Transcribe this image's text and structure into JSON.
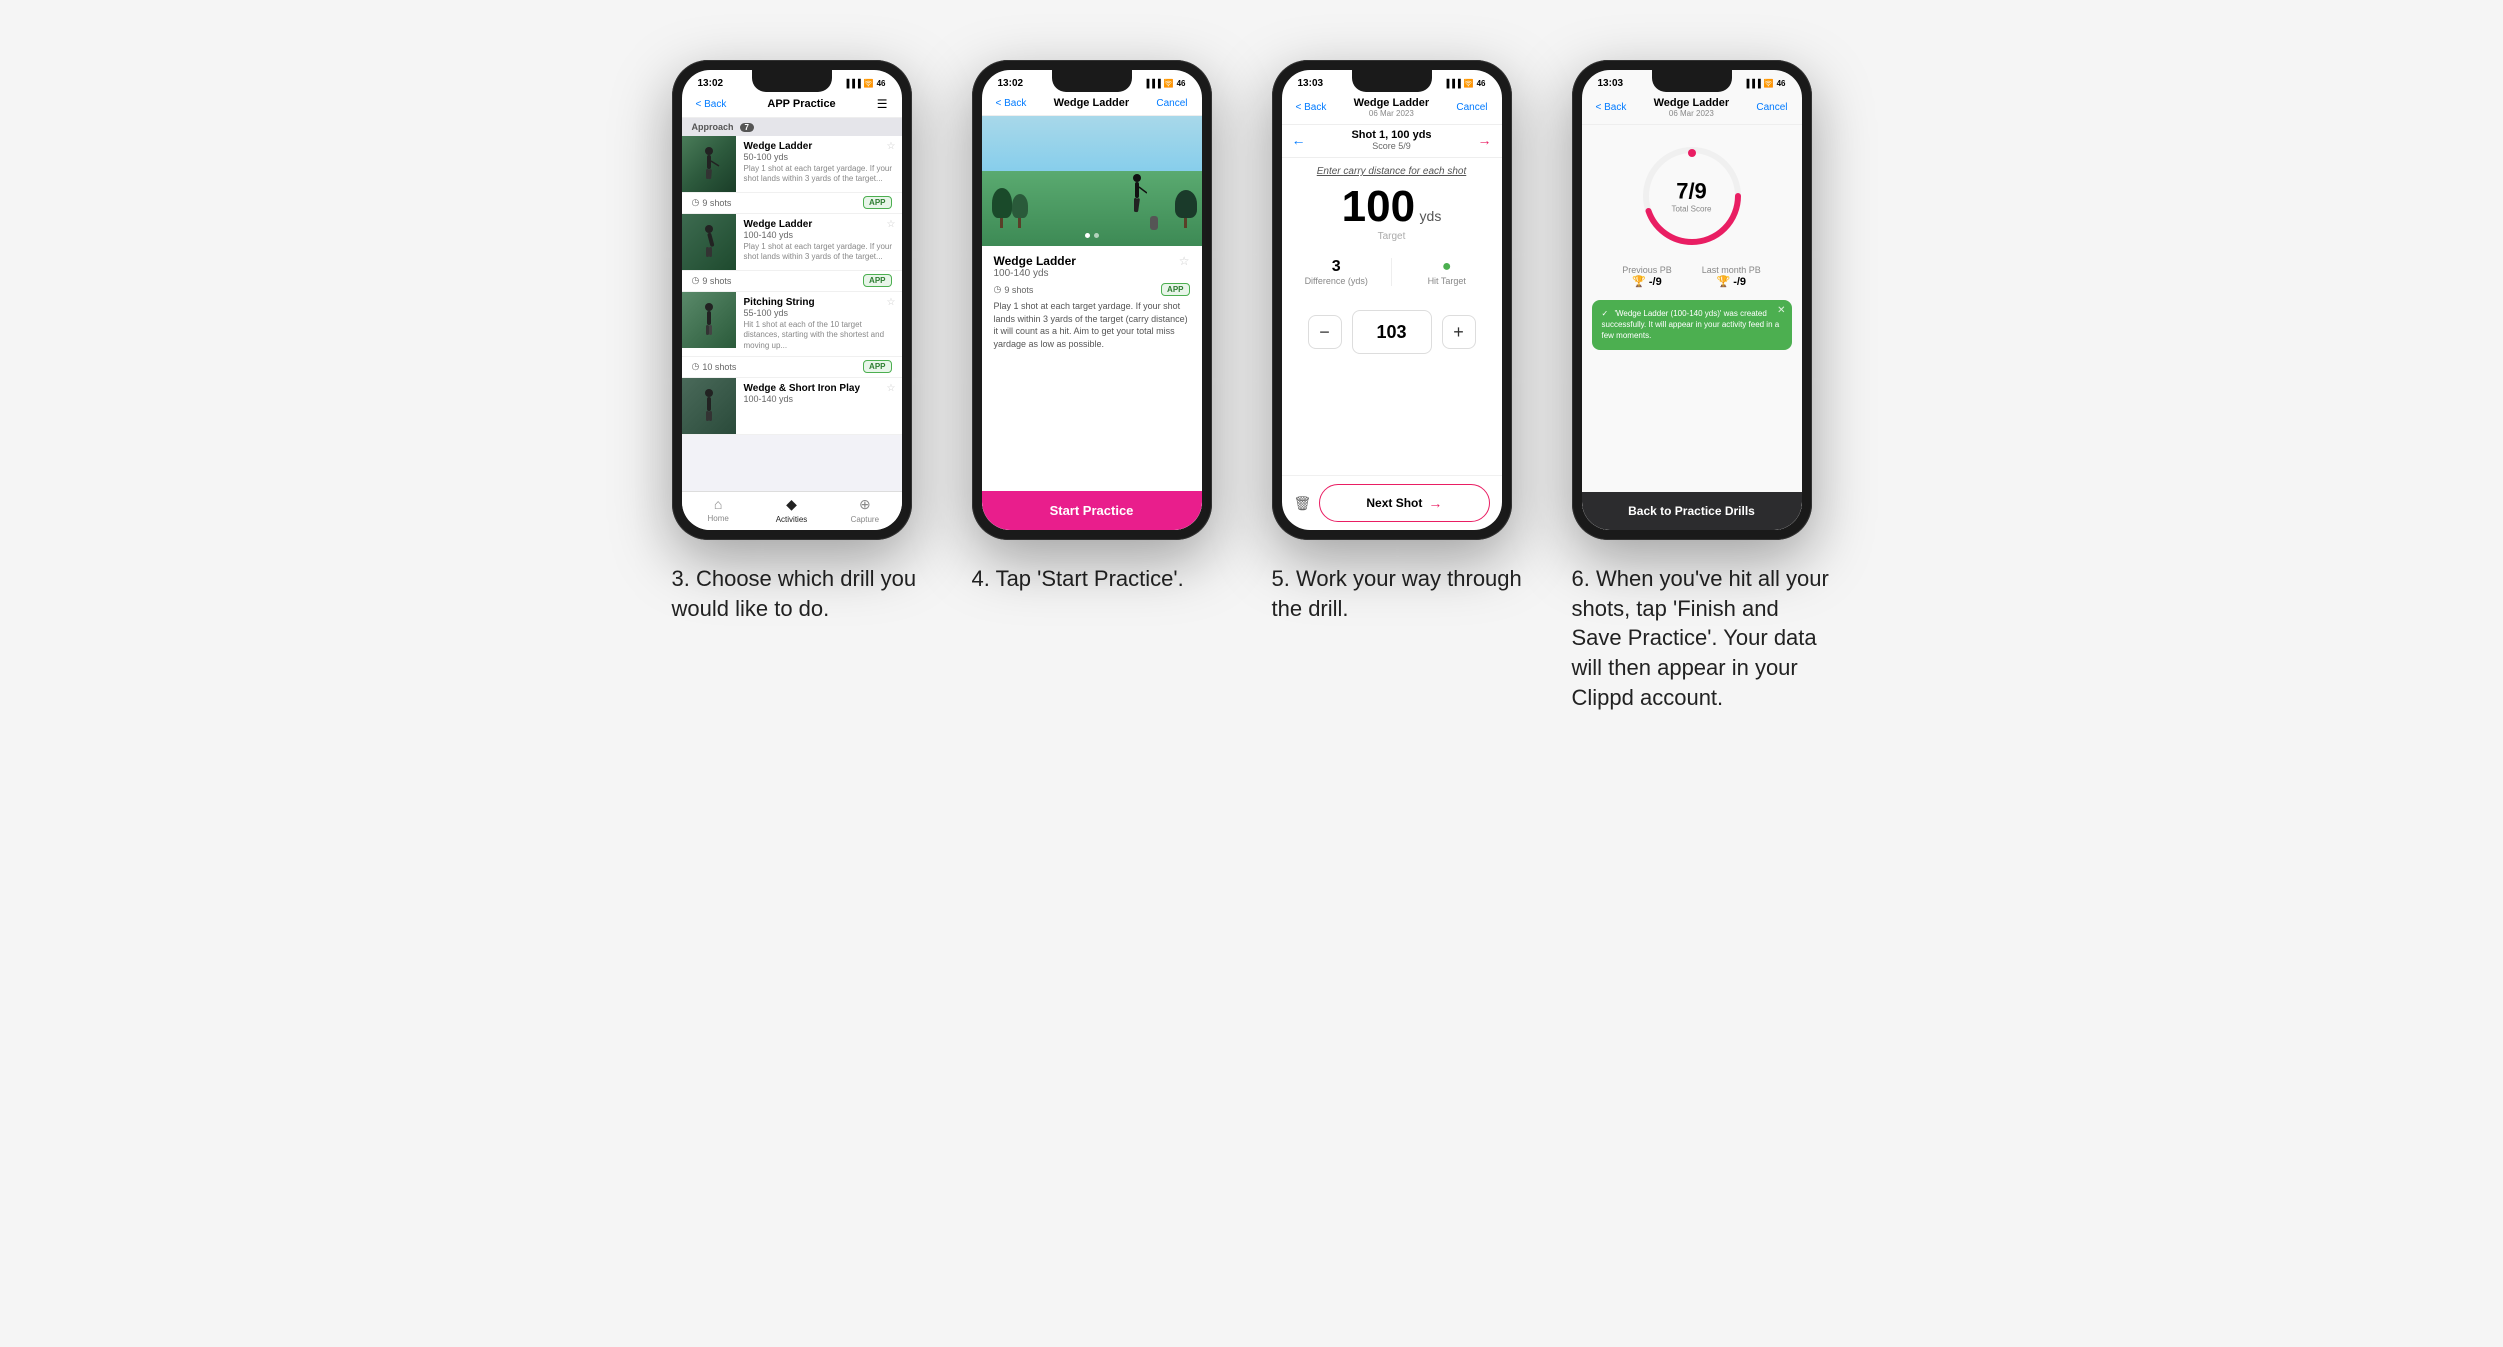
{
  "page": {
    "background": "#f5f5f5"
  },
  "steps": [
    {
      "id": "step3",
      "number": "3",
      "description": "3. Choose which drill you would like to do.",
      "phone": {
        "status_time": "13:02",
        "nav_back": "< Back",
        "nav_title": "APP Practice",
        "nav_action_icon": "hamburger",
        "section_label": "Approach",
        "section_count": "7",
        "drills": [
          {
            "name": "Wedge Ladder",
            "yds": "50-100 yds",
            "desc": "Play 1 shot at each target yardage. If your shot lands within 3 yards of the target...",
            "shots": "9 shots",
            "badge": "APP"
          },
          {
            "name": "Wedge Ladder",
            "yds": "100-140 yds",
            "desc": "Play 1 shot at each target yardage. If your shot lands within 3 yards of the target...",
            "shots": "9 shots",
            "badge": "APP"
          },
          {
            "name": "Pitching String",
            "yds": "55-100 yds",
            "desc": "Hit 1 shot at each of the 10 target distances, starting with the shortest and moving up...",
            "shots": "10 shots",
            "badge": "APP"
          },
          {
            "name": "Wedge & Short Iron Play",
            "yds": "100-140 yds",
            "desc": "",
            "shots": "",
            "badge": ""
          }
        ],
        "tabs": [
          {
            "label": "Home",
            "icon": "⌂",
            "active": false
          },
          {
            "label": "Activities",
            "icon": "♦",
            "active": true
          },
          {
            "label": "Capture",
            "icon": "+",
            "active": false
          }
        ]
      }
    },
    {
      "id": "step4",
      "number": "4",
      "description": "4. Tap 'Start Practice'.",
      "phone": {
        "status_time": "13:02",
        "nav_back": "< Back",
        "nav_title": "Wedge Ladder",
        "nav_action": "Cancel",
        "drill_name": "Wedge Ladder",
        "drill_yds": "100-140 yds",
        "drill_shots": "9 shots",
        "drill_badge": "APP",
        "drill_star": "☆",
        "drill_desc": "Play 1 shot at each target yardage. If your shot lands within 3 yards of the target (carry distance) it will count as a hit. Aim to get your total miss yardage as low as possible.",
        "start_btn": "Start Practice",
        "image_dots": 2
      }
    },
    {
      "id": "step5",
      "number": "5",
      "description": "5. Work your way through the drill.",
      "phone": {
        "status_time": "13:03",
        "nav_back": "< Back",
        "nav_title": "Wedge Ladder",
        "nav_title_sub": "06 Mar 2023",
        "nav_action": "Cancel",
        "shot_label": "Shot 1, 100 yds",
        "score_label": "Score 5/9",
        "carry_label_text": "Enter carry distance for each shot",
        "target_value": "100",
        "target_unit": "yds",
        "target_sub": "Target",
        "difference_val": "3",
        "difference_label": "Difference (yds)",
        "hit_target_label": "Hit Target",
        "input_value": "103",
        "minus_label": "−",
        "plus_label": "+",
        "next_shot_label": "Next Shot"
      }
    },
    {
      "id": "step6",
      "number": "6",
      "description": "6. When you've hit all your shots, tap 'Finish and Save Practice'. Your data will then appear in your Clippd account.",
      "phone": {
        "status_time": "13:03",
        "nav_back": "< Back",
        "nav_title": "Wedge Ladder",
        "nav_title_sub": "06 Mar 2023",
        "nav_action": "Cancel",
        "score_fraction": "7/9",
        "score_label": "Total Score",
        "previous_pb_label": "Previous PB",
        "previous_pb_val": "-/9",
        "last_month_pb_label": "Last month PB",
        "last_month_pb_val": "-/9",
        "toast_text": "'Wedge Ladder (100-140 yds)' was created successfully. It will appear in your activity feed in a few moments.",
        "back_btn": "Back to Practice Drills"
      }
    }
  ]
}
